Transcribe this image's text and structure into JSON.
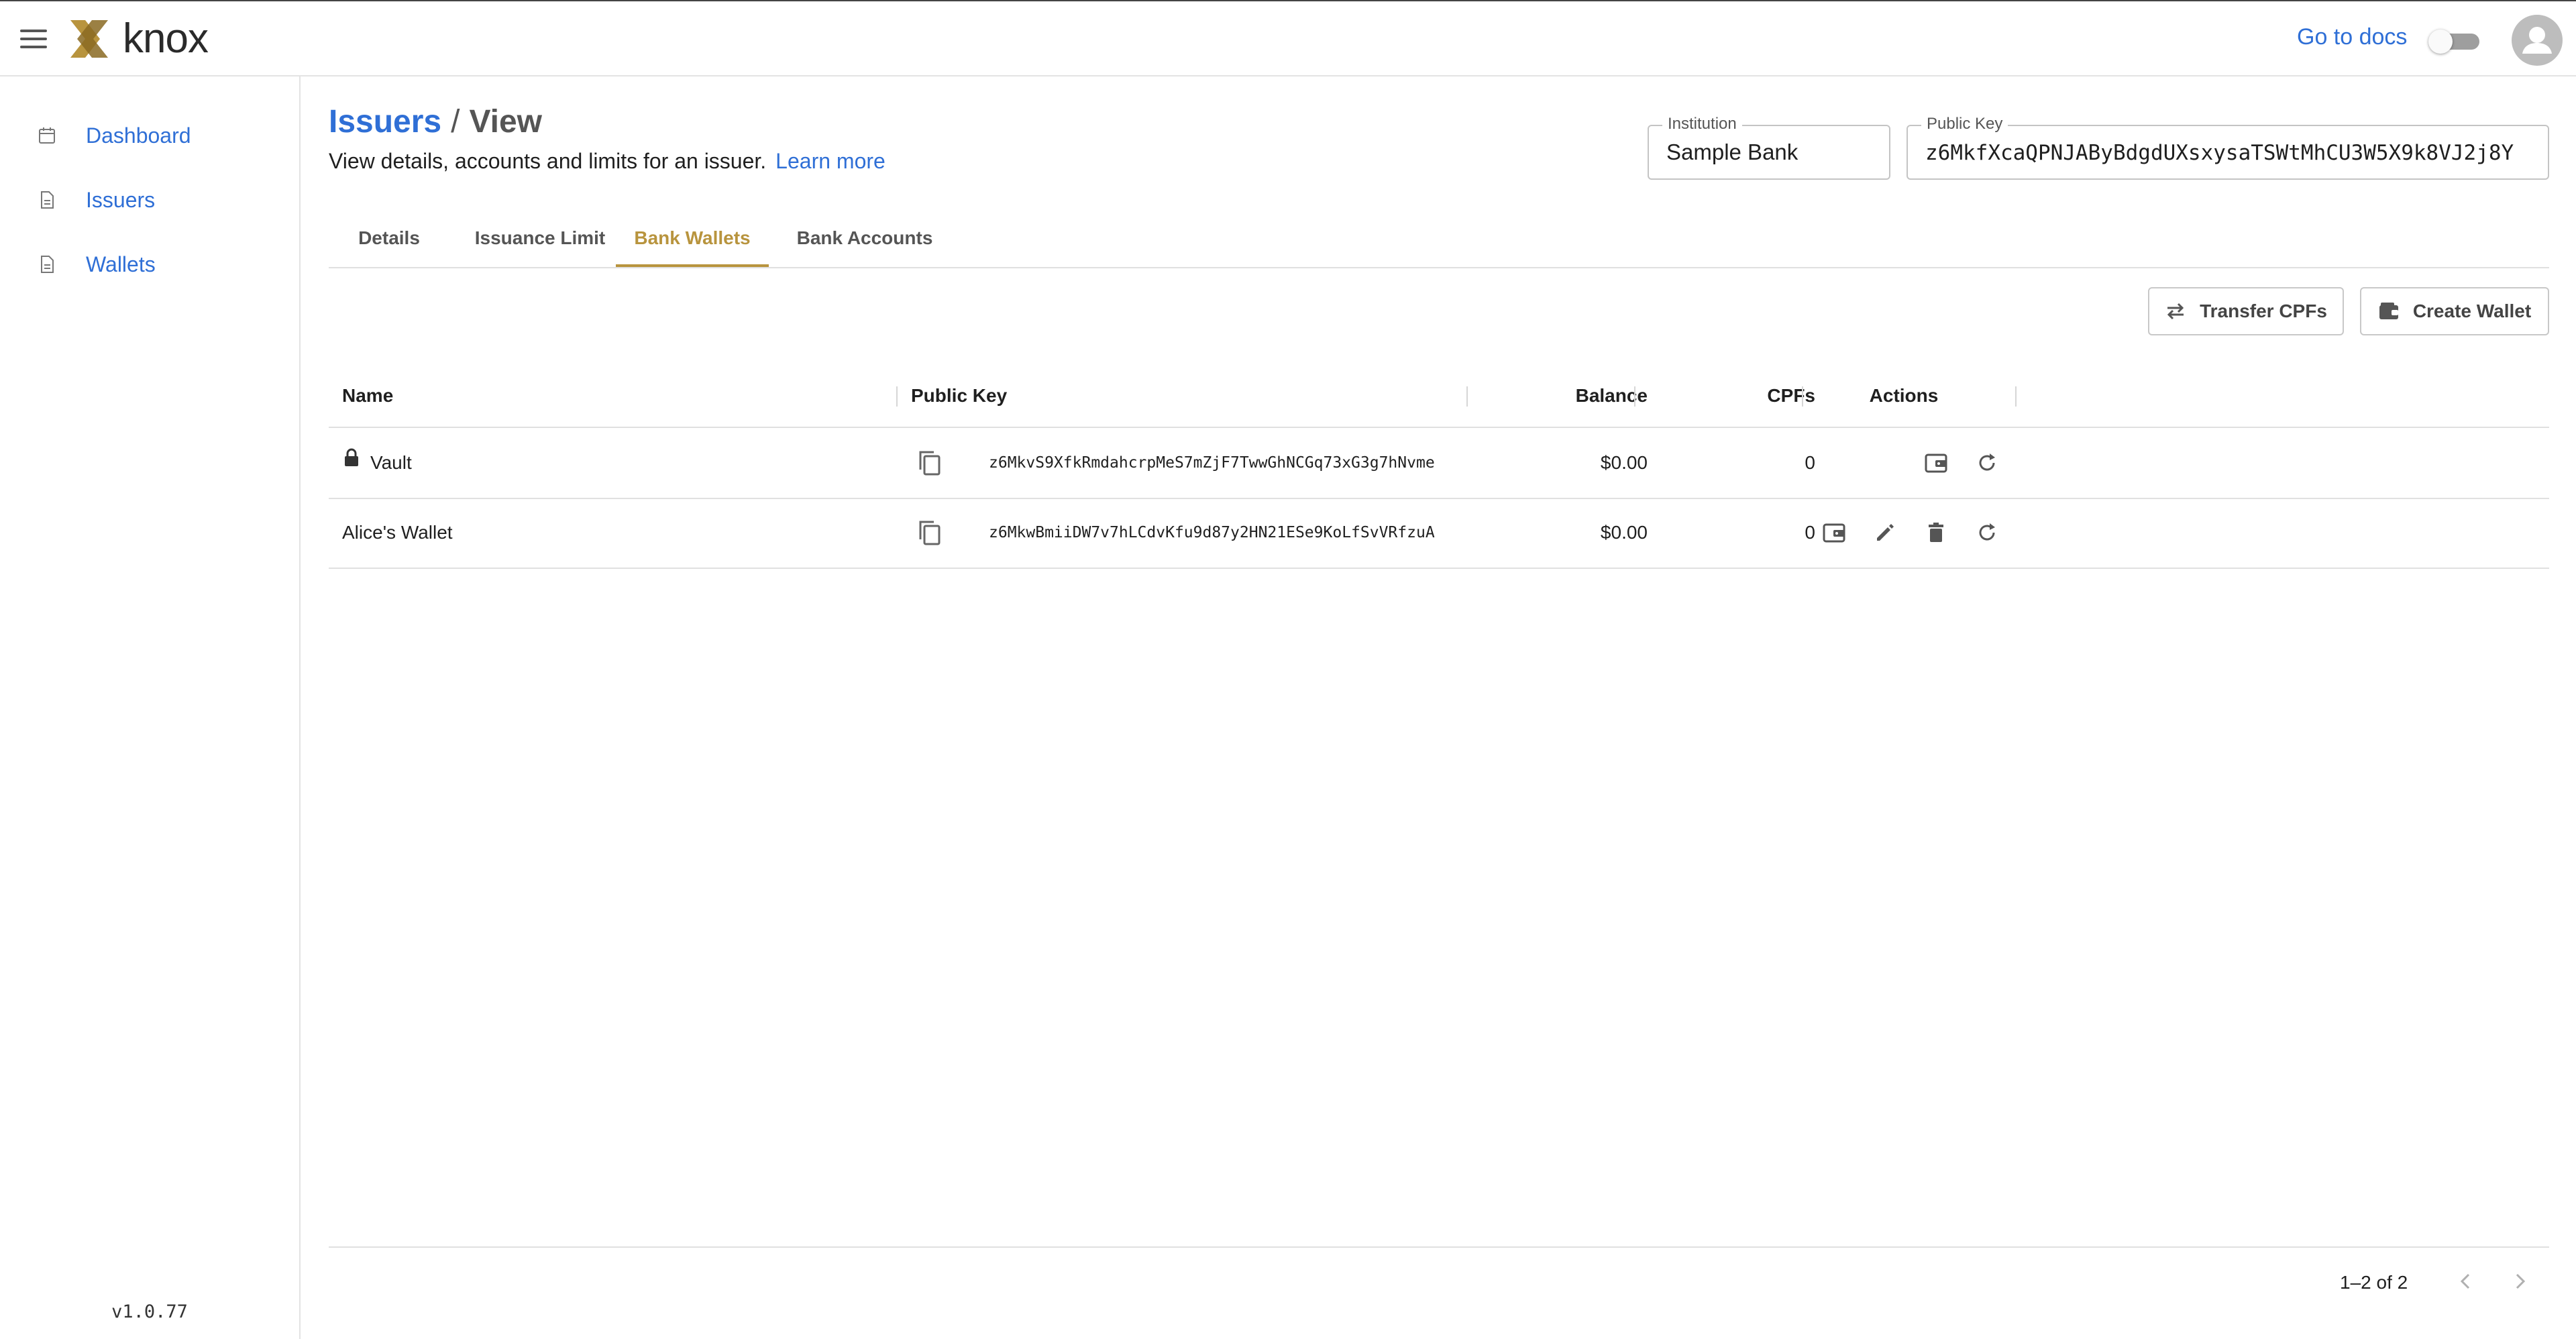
{
  "header": {
    "logo_text": "knox",
    "docs_link": "Go to docs",
    "theme_toggle_on": false
  },
  "sidebar": {
    "items": [
      {
        "label": "Dashboard",
        "icon": "calendar-icon"
      },
      {
        "label": "Issuers",
        "icon": "document-icon"
      },
      {
        "label": "Wallets",
        "icon": "document-icon"
      }
    ],
    "version": "v1.0.77"
  },
  "page": {
    "breadcrumb_parent": "Issuers",
    "breadcrumb_separator": "/",
    "breadcrumb_current": "View",
    "subtitle": "View details, accounts and limits for an issuer.",
    "learn_more": "Learn more"
  },
  "fields": {
    "institution_label": "Institution",
    "institution_value": "Sample Bank",
    "public_key_label": "Public Key",
    "public_key_value": "z6MkfXcaQPNJAByBdgdUXsxysaTSWtMhCU3W5X9k8VJ2j8Y"
  },
  "tabs": [
    {
      "label": "Details",
      "active": false
    },
    {
      "label": "Issuance Limit",
      "active": false
    },
    {
      "label": "Bank Wallets",
      "active": true
    },
    {
      "label": "Bank Accounts",
      "active": false
    }
  ],
  "actions": {
    "transfer_label": "Transfer CPFs",
    "create_wallet_label": "Create Wallet"
  },
  "table": {
    "columns": [
      "Name",
      "Public Key",
      "Balance",
      "CPFs",
      "Actions"
    ],
    "rows": [
      {
        "name": "Vault",
        "locked": true,
        "public_key": "z6MkvS9XfkRmdahcrpMeS7mZjF7TwwGhNCGq73xG3g7hNvme",
        "balance": "$0.00",
        "cpfs": "0",
        "actions": [
          "wallet-icon",
          "refresh-icon"
        ]
      },
      {
        "name": "Alice's Wallet",
        "locked": false,
        "public_key": "z6MkwBmiiDW7v7hLCdvKfu9d87y2HN21ESe9KoLfSvVRfzuA",
        "balance": "$0.00",
        "cpfs": "0",
        "actions": [
          "wallet-icon",
          "edit-icon",
          "delete-icon",
          "refresh-icon"
        ]
      }
    ]
  },
  "pagination": {
    "range": "1–2 of 2"
  },
  "colors": {
    "accent_blue": "#2f6fd6",
    "accent_gold": "#b8943e"
  }
}
